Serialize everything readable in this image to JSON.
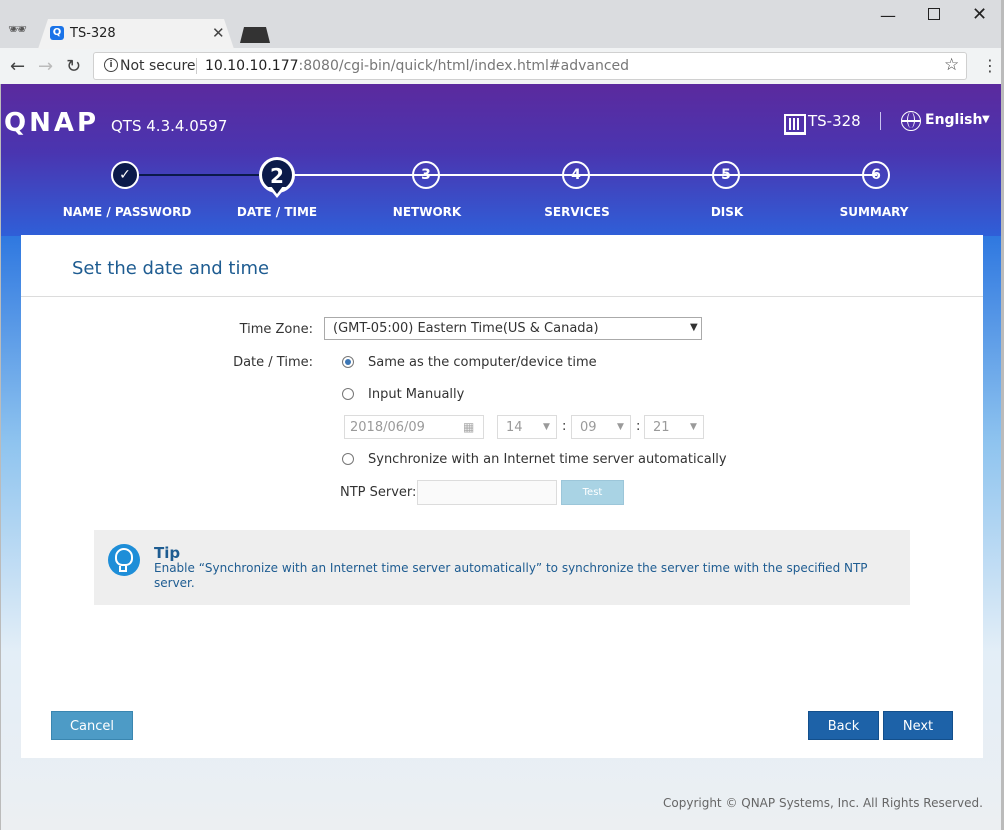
{
  "browser": {
    "tab_title": "TS-328",
    "tab_favicon": "Q",
    "tab_close": "✕",
    "security_label": "Not secure",
    "url_host": "10.10.10.177",
    "url_rest": ":8080/cgi-bin/quick/html/index.html#advanced",
    "icons": [
      "incognito-icon",
      "back-icon",
      "forward-icon",
      "reload-icon",
      "info-icon",
      "bookmark-star-icon",
      "menu-icon",
      "minimize-icon",
      "maximize-icon",
      "close-icon"
    ]
  },
  "header": {
    "logo": "QNAP",
    "version": "QTS 4.3.4.0597",
    "model": "TS-328",
    "language": "English"
  },
  "steps": [
    {
      "number": "✓",
      "label": "NAME / PASSWORD",
      "state": "done"
    },
    {
      "number": "2",
      "label": "DATE / TIME",
      "state": "active"
    },
    {
      "number": "3",
      "label": "NETWORK",
      "state": "pending"
    },
    {
      "number": "4",
      "label": "SERVICES",
      "state": "pending"
    },
    {
      "number": "5",
      "label": "DISK",
      "state": "pending"
    },
    {
      "number": "6",
      "label": "SUMMARY",
      "state": "pending"
    }
  ],
  "panel": {
    "title": "Set the date and time",
    "timezone_label": "Time Zone:",
    "timezone_value": "(GMT-05:00) Eastern Time(US & Canada)",
    "datetime_label": "Date / Time:",
    "options": [
      {
        "label": "Same as the computer/device time",
        "checked": true
      },
      {
        "label": "Input Manually",
        "checked": false
      },
      {
        "label": "Synchronize with an Internet time server automatically",
        "checked": false
      }
    ],
    "date_value": "2018/06/09",
    "hour_value": "14",
    "minute_value": "09",
    "second_value": "21",
    "time_separator": ":",
    "ntp_label": "NTP Server:",
    "ntp_value": "",
    "test_label": "Test"
  },
  "tip": {
    "title": "Tip",
    "text": "Enable “Synchronize with an Internet time server automatically” to synchronize the server time with the specified NTP server."
  },
  "buttons": {
    "cancel": "Cancel",
    "back": "Back",
    "next": "Next"
  },
  "footer": {
    "copyright": "Copyright © QNAP Systems, Inc. All Rights Reserved."
  },
  "colors": {
    "banner_top": "#5b2a9e",
    "banner_bottom": "#2f5fd8",
    "title_blue": "#1e5c91",
    "button_blue": "#1d62a8",
    "cancel_blue": "#4d9bc6",
    "tip_icon": "#1e8ed8"
  }
}
